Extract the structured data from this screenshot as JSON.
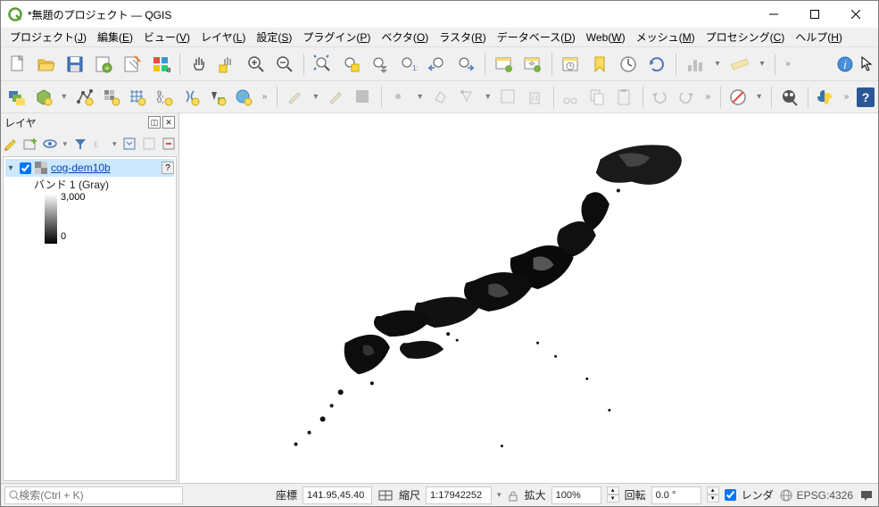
{
  "window": {
    "title": "*無題のプロジェクト — QGIS"
  },
  "menus": [
    "プロジェクト(J)",
    "編集(E)",
    "ビュー(V)",
    "レイヤ(L)",
    "設定(S)",
    "プラグイン(P)",
    "ベクタ(O)",
    "ラスタ(R)",
    "データベース(D)",
    "Web(W)",
    "メッシュ(M)",
    "プロセシング(C)",
    "ヘルプ(H)"
  ],
  "menu_underline_chars": [
    "J",
    "E",
    "V",
    "L",
    "S",
    "P",
    "O",
    "R",
    "D",
    "W",
    "M",
    "C",
    "H"
  ],
  "layers_panel": {
    "title": "レイヤ",
    "layer_name": "cog-dem10b",
    "band_label": "バンド 1 (Gray)",
    "legend_max": "3,000",
    "legend_min": "0"
  },
  "status": {
    "search_placeholder": "検索(Ctrl + K)",
    "coord_label": "座標",
    "coord_value": "141.95,45.40",
    "scale_label": "縮尺",
    "scale_value": "1:17942252",
    "magnifier_label": "拡大",
    "magnifier_value": "100%",
    "rotation_label": "回転",
    "rotation_value": "0.0 °",
    "render_label": "レンダ",
    "crs": "EPSG:4326"
  },
  "icons": {
    "new": "new-project",
    "open": "open-project",
    "save": "save",
    "save_as": "save-as",
    "layout": "layout-manager",
    "style": "style-manager",
    "pan": "pan",
    "pan_sel": "pan-to-selection",
    "zoom_in": "zoom-in",
    "zoom_out": "zoom-out",
    "zoom_full": "zoom-full",
    "zoom_sel": "zoom-to-selection",
    "zoom_layer": "zoom-to-layer",
    "zoom_native": "zoom-native",
    "zoom_last": "zoom-last",
    "zoom_next": "zoom-next",
    "new_view": "new-map-view",
    "new_3d": "new-3d-view",
    "temp_layer": "temp-scratch-layer",
    "measure": "measure",
    "statistics": "statistics",
    "refresh": "refresh",
    "select": "select-features",
    "deselect": "deselect",
    "identify": "identify",
    "vector": "add-vector",
    "raster": "add-raster",
    "mesh": "add-mesh",
    "delim": "add-delimited",
    "spatialite": "add-spatialite",
    "virtual": "add-virtual",
    "wms": "add-wms",
    "edit": "toggle-editing",
    "save_edits": "save-edits",
    "add_feat": "add-feature",
    "python": "python-console",
    "globe_search": "osm-search",
    "help": "help"
  }
}
